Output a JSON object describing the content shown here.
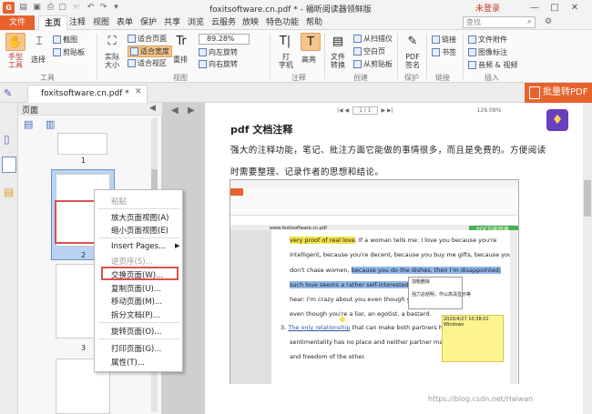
{
  "window": {
    "title": "foxitsoftware.cn.pdf * - 福昕阅读器领鲜版",
    "login": "未登录",
    "app_icon": "G",
    "min": "—",
    "max": "□",
    "close": "✕"
  },
  "menu_tabs": [
    "文件",
    "主页",
    "注释",
    "视图",
    "表单",
    "保护",
    "共享",
    "浏览",
    "云服务",
    "放映",
    "特色功能",
    "帮助"
  ],
  "search": {
    "placeholder": "查找"
  },
  "ribbon": {
    "hand": "手型\n工具",
    "select": "选择",
    "screenshot": "截图",
    "clipboard": "剪贴板",
    "actual_size": "实际\n大小",
    "fit_page": "适合页面",
    "fit_width": "适合宽度",
    "fit_view": "适合视区",
    "reflow": "重排",
    "zoom": "89.28%",
    "rotate_left": "向左旋转",
    "rotate_right": "向右旋转",
    "typewriter": "打\n字机",
    "highlight": "高亮",
    "file_convert": "文件\n转换",
    "from_scanner": "从扫描仪",
    "blank_page": "空白页",
    "from_clipboard": "从剪贴板",
    "pdf_sign": "PDF\n签名",
    "link": "链接",
    "bookmark": "书签",
    "file_attach": "文件附件",
    "image_annot": "图像标注",
    "audio_video": "音频 & 视频",
    "groups": {
      "tools": "工具",
      "view": "视图",
      "annot": "注释",
      "create": "创建",
      "protect": "保护",
      "links": "链接",
      "insert": "插入"
    }
  },
  "doc_tab": "foxitsoftware.cn.pdf *",
  "convert_button": "批量转PDF",
  "panel": {
    "title": "页面",
    "page1": "1",
    "page2": "2",
    "page3": "3"
  },
  "context_menu": [
    "粘贴",
    "放大页面视图(A)",
    "缩小页面视图(E)",
    "Insert Pages...",
    "逆页序(S)...",
    "交换页面(W)...",
    "复制页面(U)...",
    "移动页面(M)...",
    "拆分文档(P)...",
    "旋转页面(O)...",
    "打印页面(G)...",
    "属性(T)..."
  ],
  "page": {
    "heading": "pdf 文档注释",
    "line1": "强大的注释功能，笔记、批注方面它能做的事情很多，而且是免费的。方便阅读",
    "line2": "时需要整理、记录作者的思想和结论。"
  },
  "page_controls": {
    "page_indicator": "1 / 1",
    "zoom": "126.09%"
  },
  "inner": {
    "url": "www.foxitsoftware.cn.pdf",
    "convert": "PDF万能转换",
    "l1a": "very proof of real love",
    "l1b": ". If a woman tells me: I love you because you're",
    "l2": "intelligent, because you're decent, because you buy me gifts, because you",
    "l3a": "don't chase women, ",
    "l3b": "because you do the dishes, then I'm disappointed;",
    "l4": "such love seems a rather self-interested business",
    "l5": "hear: I'm crazy about you even though you're nothi",
    "l6": "even though you're a liar, an egotist, a bastard.",
    "l7a": "3.  ",
    "l7b": "The only relationship",
    "l7c": " that can make both partners happy is on",
    "l8": "sentimentality has no place and neither partner makes any claim",
    "l9": "and freedom of the other.",
    "note_author": "Windows",
    "note_time": "2020/4/27 10:38:01",
    "popup_title": "加粗删除",
    "popup_text": "强力总结明，作以高清显示等"
  },
  "watermark": "https://blog.csdn.net/Haiwan"
}
